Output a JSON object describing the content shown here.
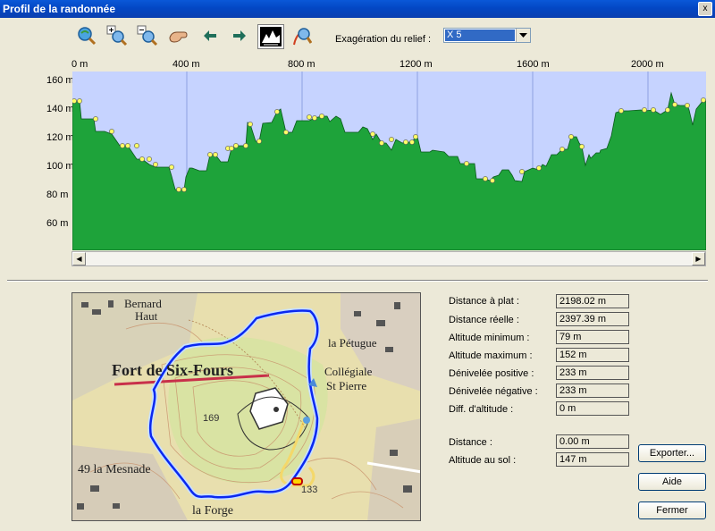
{
  "window": {
    "title": "Profil de la randonnée",
    "close_label": "x"
  },
  "toolbar": {
    "exaggeration_label": "Exagération du relief :",
    "exaggeration_value": "X 5"
  },
  "profile": {
    "x_ticks": [
      "0 m",
      "400 m",
      "800 m",
      "1200 m",
      "1600 m",
      "2000 m"
    ],
    "y_ticks": [
      "160 m",
      "140 m",
      "120 m",
      "100 m",
      "80 m",
      "60 m"
    ],
    "colors": {
      "sky": "#c6d3ff",
      "terrain": "#1ea33a",
      "waypoint": "#ffff66"
    }
  },
  "map": {
    "labels": [
      "Bernard",
      "Haut",
      "Fort de Six-Fours",
      "la Pétugue",
      "Collégiale",
      "St Pierre",
      "169",
      "49 la Mesnade",
      "la Forge",
      "133"
    ]
  },
  "stats": [
    {
      "label": "Distance à plat :",
      "value": "2198.02 m"
    },
    {
      "label": "Distance réelle :",
      "value": "2397.39 m"
    },
    {
      "label": "Altitude minimum :",
      "value": "79 m"
    },
    {
      "label": "Altitude maximum :",
      "value": "152 m"
    },
    {
      "label": "Dénivelée positive :",
      "value": "233 m"
    },
    {
      "label": "Dénivelée négative :",
      "value": "233 m"
    },
    {
      "label": "Diff. d'altitude :",
      "value": "0 m"
    },
    {
      "label": "Distance :",
      "value": "0.00 m"
    },
    {
      "label": "Altitude au sol :",
      "value": "147 m"
    }
  ],
  "buttons": {
    "export": "Exporter...",
    "help": "Aide",
    "close": "Fermer"
  }
}
